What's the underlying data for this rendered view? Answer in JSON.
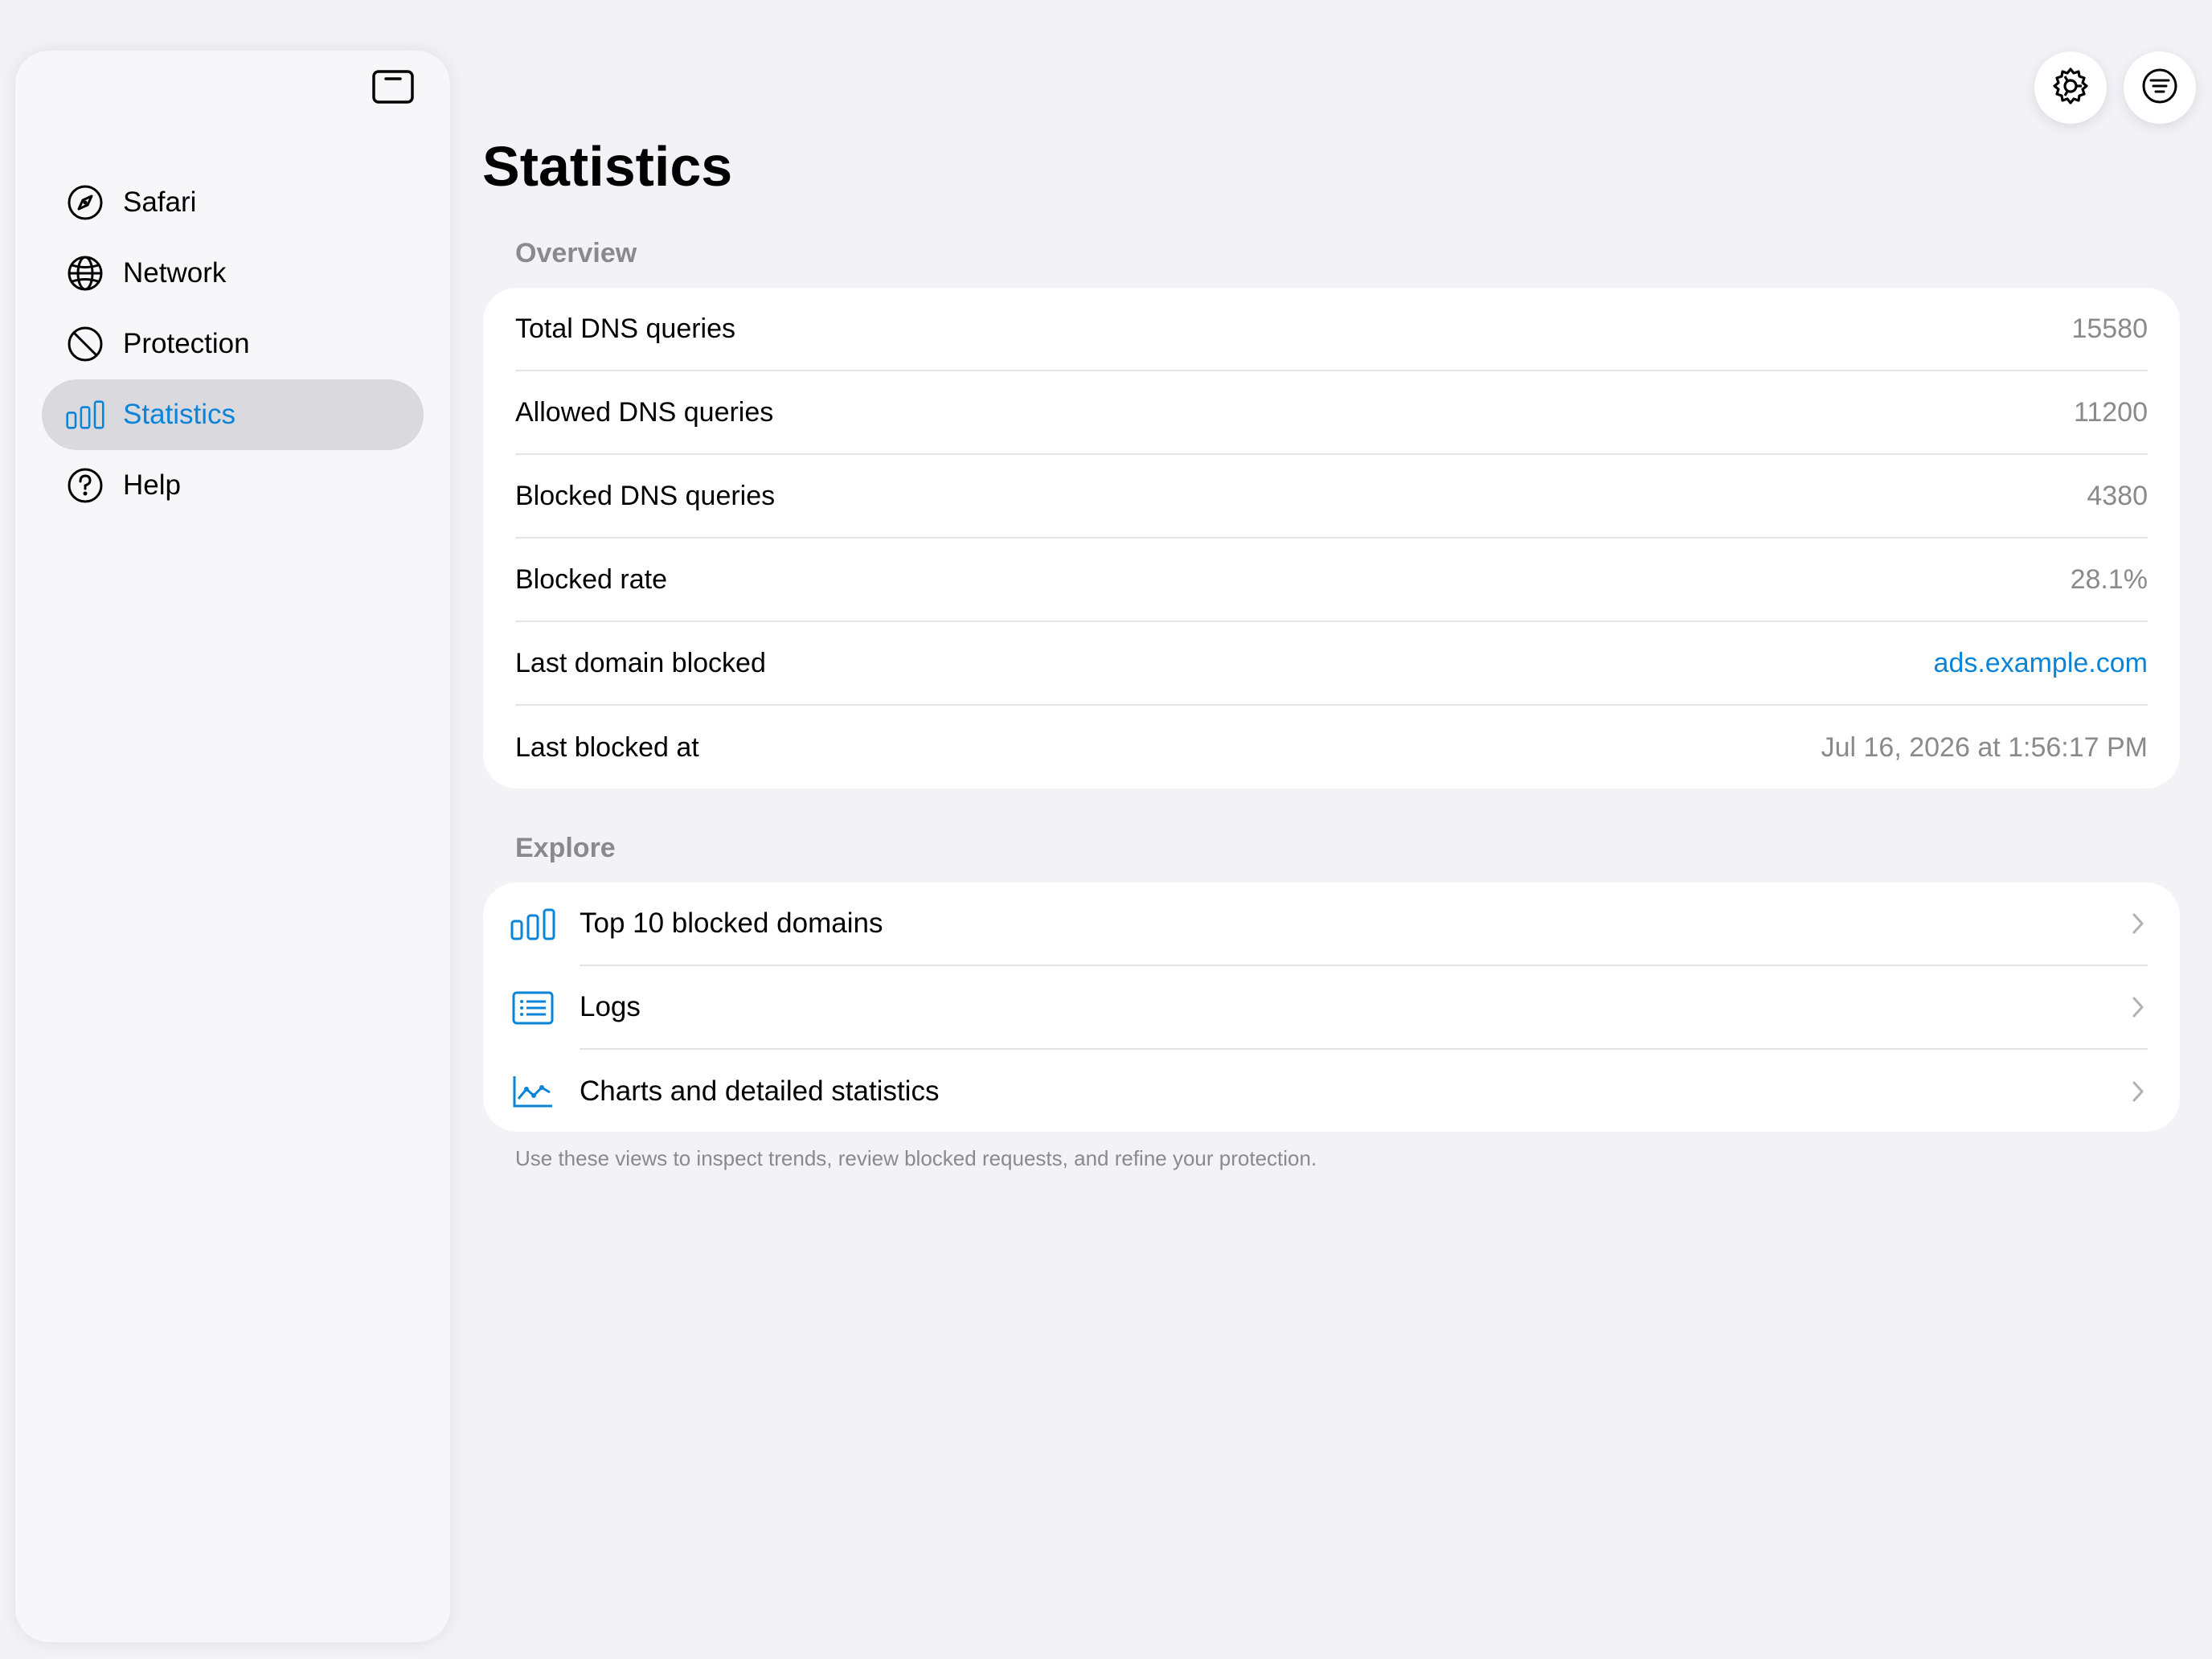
{
  "sidebar": {
    "items": [
      {
        "label": "Safari",
        "icon": "compass-icon",
        "active": false
      },
      {
        "label": "Network",
        "icon": "globe-icon",
        "active": false
      },
      {
        "label": "Protection",
        "icon": "prohibited-icon",
        "active": false
      },
      {
        "label": "Statistics",
        "icon": "bar-chart-icon",
        "active": true
      },
      {
        "label": "Help",
        "icon": "question-circle-icon",
        "active": false
      }
    ]
  },
  "toolbar": {
    "icons": [
      "gear-icon",
      "filter-menu-icon"
    ]
  },
  "page": {
    "title": "Statistics"
  },
  "overview": {
    "header": "Overview",
    "rows": [
      {
        "label": "Total DNS queries",
        "value": "15580"
      },
      {
        "label": "Allowed DNS queries",
        "value": "11200"
      },
      {
        "label": "Blocked DNS queries",
        "value": "4380"
      },
      {
        "label": "Blocked rate",
        "value": "28.1%"
      },
      {
        "label": "Last domain blocked",
        "value": "ads.example.com"
      },
      {
        "label": "Last blocked at",
        "value": "Jul 16, 2026 at 1:56:17 PM"
      }
    ]
  },
  "explore": {
    "header": "Explore",
    "items": [
      {
        "label": "Top 10 blocked domains",
        "icon": "bar-chart-icon"
      },
      {
        "label": "Logs",
        "icon": "list-icon"
      },
      {
        "label": "Charts and detailed statistics",
        "icon": "line-chart-icon"
      }
    ],
    "footer": "Use these views to inspect trends, review blocked requests, and refine your protection."
  },
  "colors": {
    "accent": "#0a84d8",
    "background": "#f2f2f7",
    "secondary_text": "#8a8a8e"
  }
}
